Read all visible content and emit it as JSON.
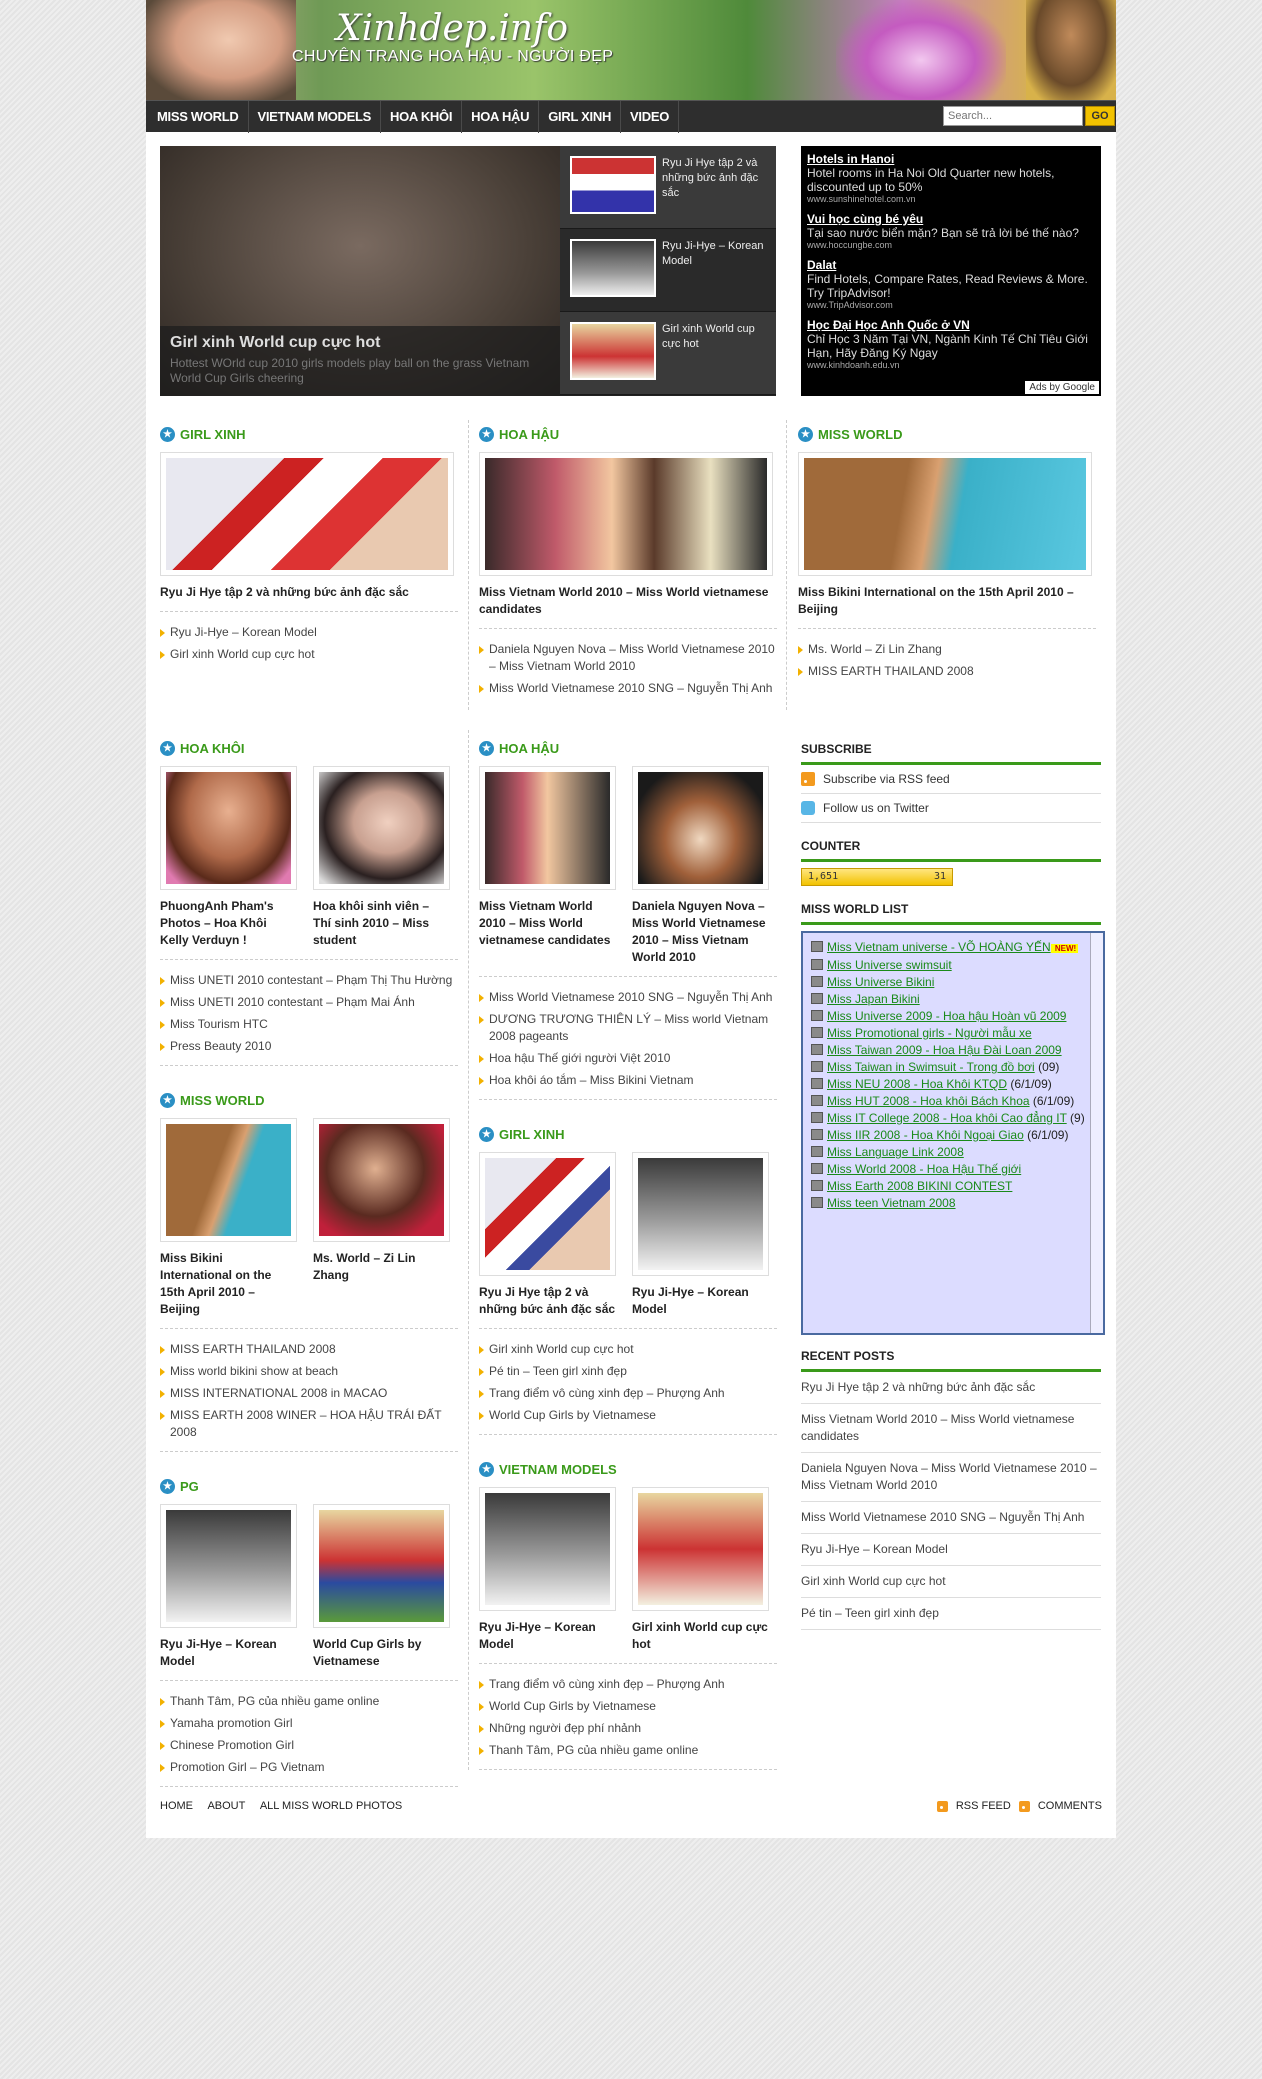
{
  "header": {
    "logo": "Xinhdep.info",
    "tagline": "CHUYÊN TRANG HOA HẬU - NGƯỜI ĐẸP"
  },
  "nav": [
    "MISS WORLD",
    "VIETNAM MODELS",
    "HOA KHÔI",
    "HOA HẬU",
    "GIRL XINH",
    "VIDEO"
  ],
  "search": {
    "placeholder": "Search...",
    "button": "GO"
  },
  "featured": {
    "title": "Girl xinh World cup cực hot",
    "desc": "Hottest WOrld cup 2010 girls models play ball on the grass Vietnam World Cup Girls cheering",
    "items": [
      "Ryu Ji Hye tập 2 và những bức ảnh đặc sắc",
      "Ryu Ji-Hye – Korean Model",
      "Girl xinh World cup cực hot"
    ]
  },
  "ads": [
    {
      "title": "Hotels in Hanoi",
      "text": "Hotel rooms in Ha Noi Old Quarter new hotels, discounted up to 50%",
      "url": "www.sunshinehotel.com.vn"
    },
    {
      "title": "Vui học cùng bé yêu",
      "text": "Tại sao nước biển mặn? Bạn sẽ trả lời bé thế nào?",
      "url": "www.hoccungbe.com"
    },
    {
      "title": "Dalat",
      "text": "Find Hotels, Compare Rates, Read Reviews & More. Try TripAdvisor!",
      "url": "www.TripAdvisor.com"
    },
    {
      "title": "Học Đại Học Anh Quốc ở VN",
      "text": "Chỉ Học 3 Năm Tại VN, Ngành Kinh Tế Chỉ Tiêu Giới Hạn, Hãy Đăng Ký Ngay",
      "url": "www.kinhdoanh.edu.vn"
    }
  ],
  "ads_by": "Ads by Google",
  "row1": [
    {
      "title": "GIRL XINH",
      "post": "Ryu Ji Hye tập 2 và những bức ảnh đặc sắc",
      "links": [
        "Ryu Ji-Hye – Korean Model",
        "Girl xinh World cup cực hot"
      ]
    },
    {
      "title": "HOA HẬU",
      "post": "Miss Vietnam World 2010 – Miss World vietnamese candidates",
      "links": [
        "Daniela Nguyen Nova – Miss World Vietnamese 2010 – Miss Vietnam World 2010",
        "Miss World Vietnamese 2010 SNG – Nguyễn Thị Anh"
      ]
    },
    {
      "title": "MISS WORLD",
      "post": "Miss Bikini International on the 15th April 2010 – Beijing",
      "links": [
        "Ms. World – Zi Lin Zhang",
        "MISS EARTH THAILAND 2008"
      ]
    }
  ],
  "left_col": [
    {
      "title": "HOA KHÔI",
      "posts": [
        "PhuongAnh Pham's Photos – Hoa Khôi Kelly Verduyn !",
        "Hoa khôi sinh viên – Thí sinh 2010 – Miss student"
      ],
      "links": [
        "Miss UNETI 2010 contestant – Phạm Thị Thu Hường",
        "Miss UNETI 2010 contestant – Phạm Mai Ánh",
        "Miss Tourism HTC",
        "Press Beauty 2010"
      ]
    },
    {
      "title": "MISS WORLD",
      "posts": [
        "Miss Bikini International on the 15th April 2010 – Beijing",
        "Ms. World – Zi Lin Zhang"
      ],
      "links": [
        "MISS EARTH THAILAND 2008",
        "Miss world bikini show at beach",
        "MISS INTERNATIONAL 2008 in MACAO",
        "MISS EARTH 2008 WINER – HOA HẬU TRÁI ĐẤT 2008"
      ]
    },
    {
      "title": "PG",
      "posts": [
        "Ryu Ji-Hye – Korean Model",
        "World Cup Girls by Vietnamese"
      ],
      "links": [
        "Thanh Tâm, PG của nhiều game online",
        "Yamaha promotion Girl",
        "Chinese Promotion Girl",
        "Promotion Girl – PG Vietnam"
      ]
    }
  ],
  "mid_col": [
    {
      "title": "HOA HẬU",
      "posts": [
        "Miss Vietnam World 2010 – Miss World vietnamese candidates",
        "Daniela Nguyen Nova – Miss World Vietnamese 2010 – Miss Vietnam World 2010"
      ],
      "links": [
        "Miss World Vietnamese 2010 SNG – Nguyễn Thị Anh",
        "DƯƠNG TRƯƠNG THIÊN LÝ – Miss world Vietnam 2008 pageants",
        "Hoa hậu Thế giới người Việt 2010",
        "Hoa khôi áo tắm – Miss Bikini Vietnam"
      ]
    },
    {
      "title": "GIRL XINH",
      "posts": [
        "Ryu Ji Hye tập 2 và những bức ảnh đặc sắc",
        "Ryu Ji-Hye – Korean Model"
      ],
      "links": [
        "Girl xinh World cup cực hot",
        "Pé tin – Teen girl xinh đẹp",
        "Trang điểm vô cùng xinh đẹp – Phượng Anh",
        "World Cup Girls by Vietnamese"
      ]
    },
    {
      "title": "VIETNAM MODELS",
      "posts": [
        "Ryu Ji-Hye – Korean Model",
        "Girl xinh World cup cực hot"
      ],
      "links": [
        "Trang điểm vô cùng xinh đẹp – Phượng Anh",
        "World Cup Girls by Vietnamese",
        "Những người đẹp phí nhảnh",
        "Thanh Tâm, PG của nhiều game online"
      ]
    }
  ],
  "sidebar": {
    "subscribe_title": "SUBSCRIBE",
    "rss": "Subscribe via RSS feed",
    "twitter": "Follow us on Twitter",
    "counter_title": "COUNTER",
    "counter_total": "1,651",
    "counter_today": "31",
    "mwlist_title": "MISS WORLD LIST",
    "mwlist": [
      [
        "Miss Vietnam universe - VÕ HOÀNG YẾN",
        "NEW!"
      ],
      [
        "Miss Universe swimsuit",
        ""
      ],
      [
        "Miss Universe Bikini",
        ""
      ],
      [
        "Miss Japan Bikini",
        ""
      ],
      [
        "Miss Universe 2009 - Hoa hậu Hoàn vũ 2009",
        ""
      ],
      [
        "Miss Promotional girls - Người mẫu xe",
        ""
      ],
      [
        "Miss Taiwan 2009 - Hoa Hậu Đài Loan 2009",
        ""
      ],
      [
        "Miss Taiwan in Swimsuit - Trong đồ bơi",
        "(09)"
      ],
      [
        "Miss NEU 2008 - Hoa Khôi KTQD",
        "(6/1/09)"
      ],
      [
        "Miss HUT 2008 - Hoa khôi Bách Khoa",
        "(6/1/09)"
      ],
      [
        "Miss IT College 2008 - Hoa khôi Cao đẳng IT",
        "(9)"
      ],
      [
        "Miss IIR 2008 - Hoa Khôi Ngoại Giao",
        "(6/1/09)"
      ],
      [
        "Miss Language Link 2008",
        ""
      ],
      [
        "Miss World 2008 - Hoa Hậu Thế giới",
        ""
      ],
      [
        "Miss Earth 2008 BIKINI CONTEST",
        ""
      ],
      [
        "Miss teen Vietnam 2008",
        ""
      ]
    ],
    "recent_title": "RECENT POSTS",
    "recent": [
      "Ryu Ji Hye tập 2 và những bức ảnh đặc sắc",
      "Miss Vietnam World 2010 – Miss World vietnamese candidates",
      "Daniela Nguyen Nova – Miss World Vietnamese 2010 – Miss Vietnam World 2010",
      "Miss World Vietnamese 2010 SNG – Nguyễn Thị Anh",
      "Ryu Ji-Hye – Korean Model",
      "Girl xinh World cup cực hot",
      "Pé tin – Teen girl xinh đẹp"
    ]
  },
  "footer": {
    "links": [
      "HOME",
      "ABOUT",
      "ALL MISS WORLD PHOTOS"
    ],
    "rss": "RSS FEED",
    "comments": "COMMENTS"
  },
  "colors": {
    "accent": "#3a9a1a",
    "nav_bg": "#2e2e2e",
    "go": "#f2c200",
    "icon_blue": "#2a8fc4"
  }
}
